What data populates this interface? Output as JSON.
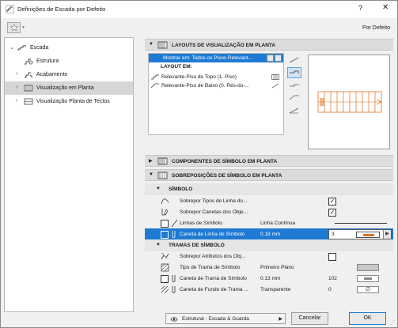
{
  "window": {
    "title": "Definições de Escada por Defeito",
    "help": "?",
    "close": "✕"
  },
  "toolbar": {
    "default_label": "Por Defeito"
  },
  "tree": [
    {
      "label": "Escada",
      "chev": "⌄"
    },
    {
      "label": "Estrutura",
      "chev": ""
    },
    {
      "label": "Acabamento",
      "chev": "›"
    },
    {
      "label": "Visualização em Planta",
      "chev": "›"
    },
    {
      "label": "Visualização Planta de Tectos",
      "chev": "›"
    }
  ],
  "sections": {
    "layouts_title": "LAYOUTS DE VISUALIZAÇÃO EM PLANTA",
    "components_title": "COMPONENTES DE SÍMBOLO EM PLANTA",
    "overrides_title": "SOBREPOSIÇÕES DE SÍMBOLO EM PLANTA"
  },
  "layouts": {
    "show_on": "Mostrar em: Todos os Pisos Relevant...",
    "layout_header": "LAYOUT EM:",
    "rows": [
      {
        "label": "Relevante-Piso de Topo (1. Piso)"
      },
      {
        "label": "Relevante-Piso de Baixo (0. Rés-do-..."
      }
    ]
  },
  "overrides": {
    "symbol_group": "SÍMBOLO",
    "override_line_types": "Sobrepor Tipos de Linha do...",
    "override_pens": "Sobrepor Canetas dos Obje...",
    "symbol_lines": "Linhas de Símbolo",
    "symbol_lines_value": "Linha Contínua",
    "symbol_line_pen": "Caneta de Linha de Símbolo",
    "symbol_line_pen_value": "0.18 mm",
    "symbol_line_pen_number": "3",
    "hatch_group": "TRAMAS DE SÍMBOLO",
    "override_fill_attrs": "Sobrepor Atributos dos Obj...",
    "hatch_type": "Tipo de Trama de Símbolo",
    "hatch_type_value": "Primeiro Plano",
    "hatch_pen": "Caneta de Trama de Símbolo",
    "hatch_pen_value": "0.13 mm",
    "hatch_pen_number": "102",
    "hatch_bg_pen": "Caneta de Fundo de Trama ...",
    "hatch_bg_pen_value": "Transparente",
    "hatch_bg_pen_number": "0",
    "empty_symbol": "∅",
    "check_mark": "✓",
    "pen_color": "#e07020"
  },
  "footer": {
    "favorite": "Estrutural - Escada & Guarda",
    "cancel": "Cancelar",
    "ok": "OK"
  },
  "accent_color": "#1e7ad2"
}
